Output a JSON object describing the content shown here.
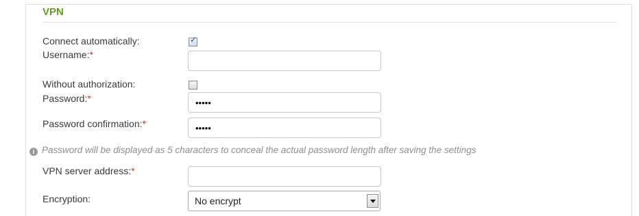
{
  "section": {
    "title": "VPN"
  },
  "fields": {
    "connect_automatically": {
      "label": "Connect automatically:",
      "checked": true
    },
    "username": {
      "label": "Username:",
      "required_mark": "*",
      "value": ""
    },
    "without_authorization": {
      "label": "Without authorization:",
      "checked": false
    },
    "password": {
      "label": "Password:",
      "required_mark": "*",
      "value": "•••••"
    },
    "password_confirmation": {
      "label": "Password confirmation:",
      "required_mark": "*",
      "value": "•••••"
    },
    "hint": {
      "icon": "info-icon",
      "text": "Password will be displayed as 5 characters to conceal the actual password length after saving the settings"
    },
    "vpn_server_address": {
      "label": "VPN server address:",
      "required_mark": "*",
      "value": ""
    },
    "encryption": {
      "label": "Encryption:",
      "selected": "No encrypt"
    }
  },
  "colors": {
    "title": "#669b1e",
    "required": "#e0301e",
    "hint": "#8f8f8f"
  }
}
